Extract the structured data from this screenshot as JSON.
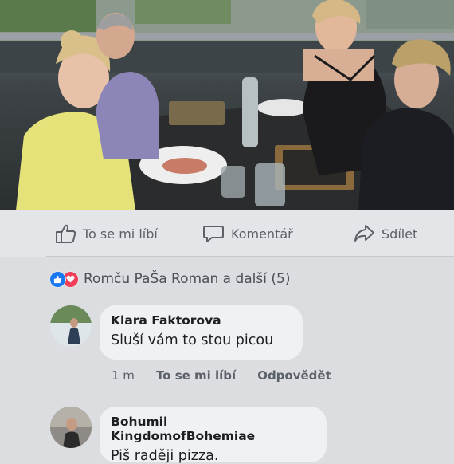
{
  "actions": {
    "like": "To se mi líbí",
    "comment": "Komentář",
    "share": "Sdílet"
  },
  "reactions": {
    "summary": "Romču PaŠa Roman a další (5)",
    "icons": [
      "like-icon",
      "love-icon"
    ]
  },
  "comments": [
    {
      "author": "Klara Faktorova",
      "text": "Sluší vám to stou picou",
      "time": "1 m",
      "like": "To se mi líbí",
      "reply": "Odpovědět"
    },
    {
      "author": "Bohumil KingdomofBohemiae",
      "text": "Piš raději pizza."
    }
  ],
  "colors": {
    "background": "#dcdde1",
    "bubble": "#f0f1f3",
    "like_blue": "#1877f2",
    "love_red": "#f33e58",
    "muted_text": "#5b6169"
  }
}
